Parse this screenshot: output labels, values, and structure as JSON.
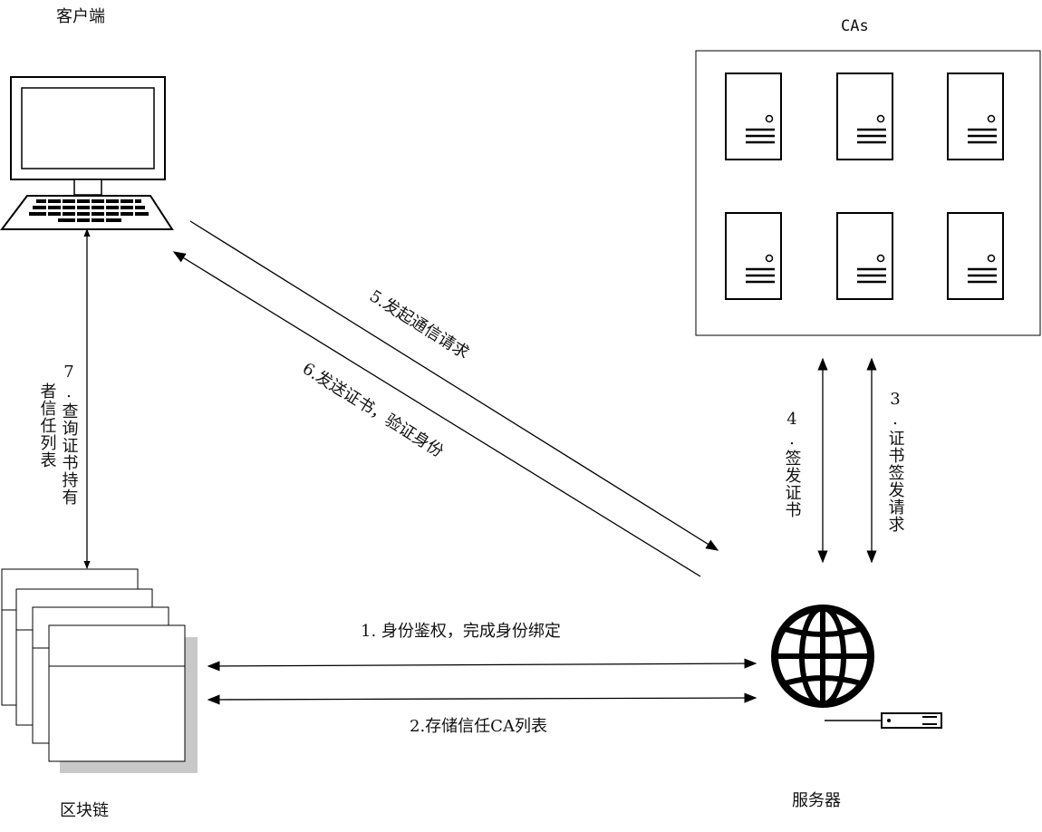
{
  "labels": {
    "client": "客户端",
    "cas": "CAs",
    "blockchain": "区块链",
    "server": "服务器"
  },
  "steps": {
    "s1": "1.  身份鉴权，完成身份绑定",
    "s2": "2.存储信任CA列表",
    "s3": "3.证书签发请求",
    "s4": "4.签发证书",
    "s5": "5.发起通信请求",
    "s6": "6.发送证书，验证身份",
    "s7_line1": "7.查询证书持有",
    "s7_line2": "者信任列表"
  },
  "colors": {
    "stroke": "#000000",
    "background": "#ffffff",
    "shadow": "#c8c8c8"
  }
}
